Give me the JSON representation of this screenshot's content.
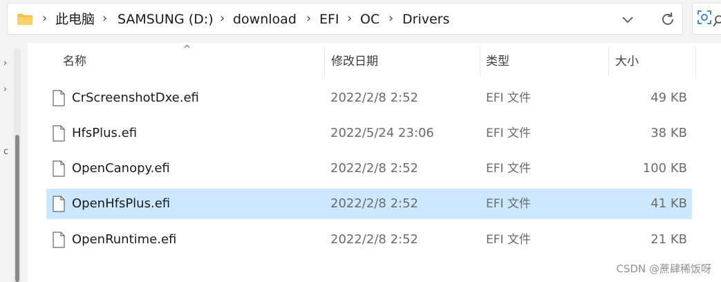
{
  "address_bar": {
    "folder_icon": "folder-icon",
    "breadcrumb": [
      "此电脑",
      "SAMSUNG (D:)",
      "download",
      "EFI",
      "OC",
      "Drivers"
    ],
    "separator": "›"
  },
  "columns": {
    "name": "名称",
    "modified": "修改日期",
    "type": "类型",
    "size": "大小",
    "sort_indicator": "^"
  },
  "files": [
    {
      "name": "CrScreenshotDxe.efi",
      "modified": "2022/2/8 2:52",
      "type": "EFI 文件",
      "size": "49 KB",
      "selected": false
    },
    {
      "name": "HfsPlus.efi",
      "modified": "2022/5/24 23:06",
      "type": "EFI 文件",
      "size": "38 KB",
      "selected": false
    },
    {
      "name": "OpenCanopy.efi",
      "modified": "2022/2/8 2:52",
      "type": "EFI 文件",
      "size": "100 KB",
      "selected": false
    },
    {
      "name": "OpenHfsPlus.efi",
      "modified": "2022/2/8 2:52",
      "type": "EFI 文件",
      "size": "41 KB",
      "selected": true
    },
    {
      "name": "OpenRuntime.efi",
      "modified": "2022/2/8 2:52",
      "type": "EFI 文件",
      "size": "21 KB",
      "selected": false
    }
  ],
  "watermark": "CSDN @蔗肆稀饭呀",
  "colors": {
    "selected_row": "#cce8ff",
    "folder": "#f2c14e"
  }
}
